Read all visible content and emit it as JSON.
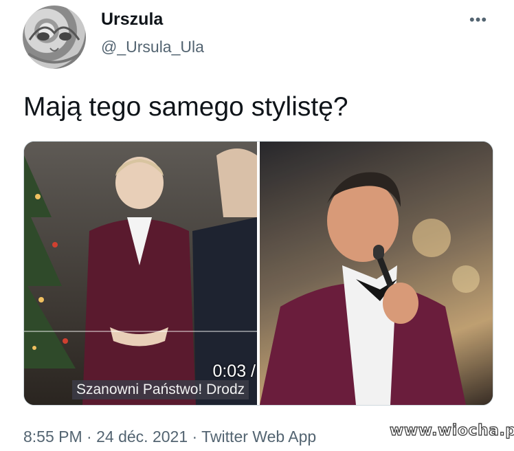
{
  "user": {
    "display_name": "Urszula",
    "handle": "@_Ursula_Ula",
    "more_icon": "more-dots-icon"
  },
  "tweet": {
    "text": "Mają tego samego stylistę?"
  },
  "media": {
    "timecode": "0:03 /",
    "subtitle": "Szanowni Państwo! Drodz"
  },
  "meta": {
    "time": "8:55 PM",
    "separator": "·",
    "date": "24 déc. 2021",
    "source": "Twitter Web App"
  },
  "watermark": "www.wiocha.pl",
  "colors": {
    "text": "#0f1419",
    "secondary": "#536471",
    "border": "#cfd9de"
  }
}
